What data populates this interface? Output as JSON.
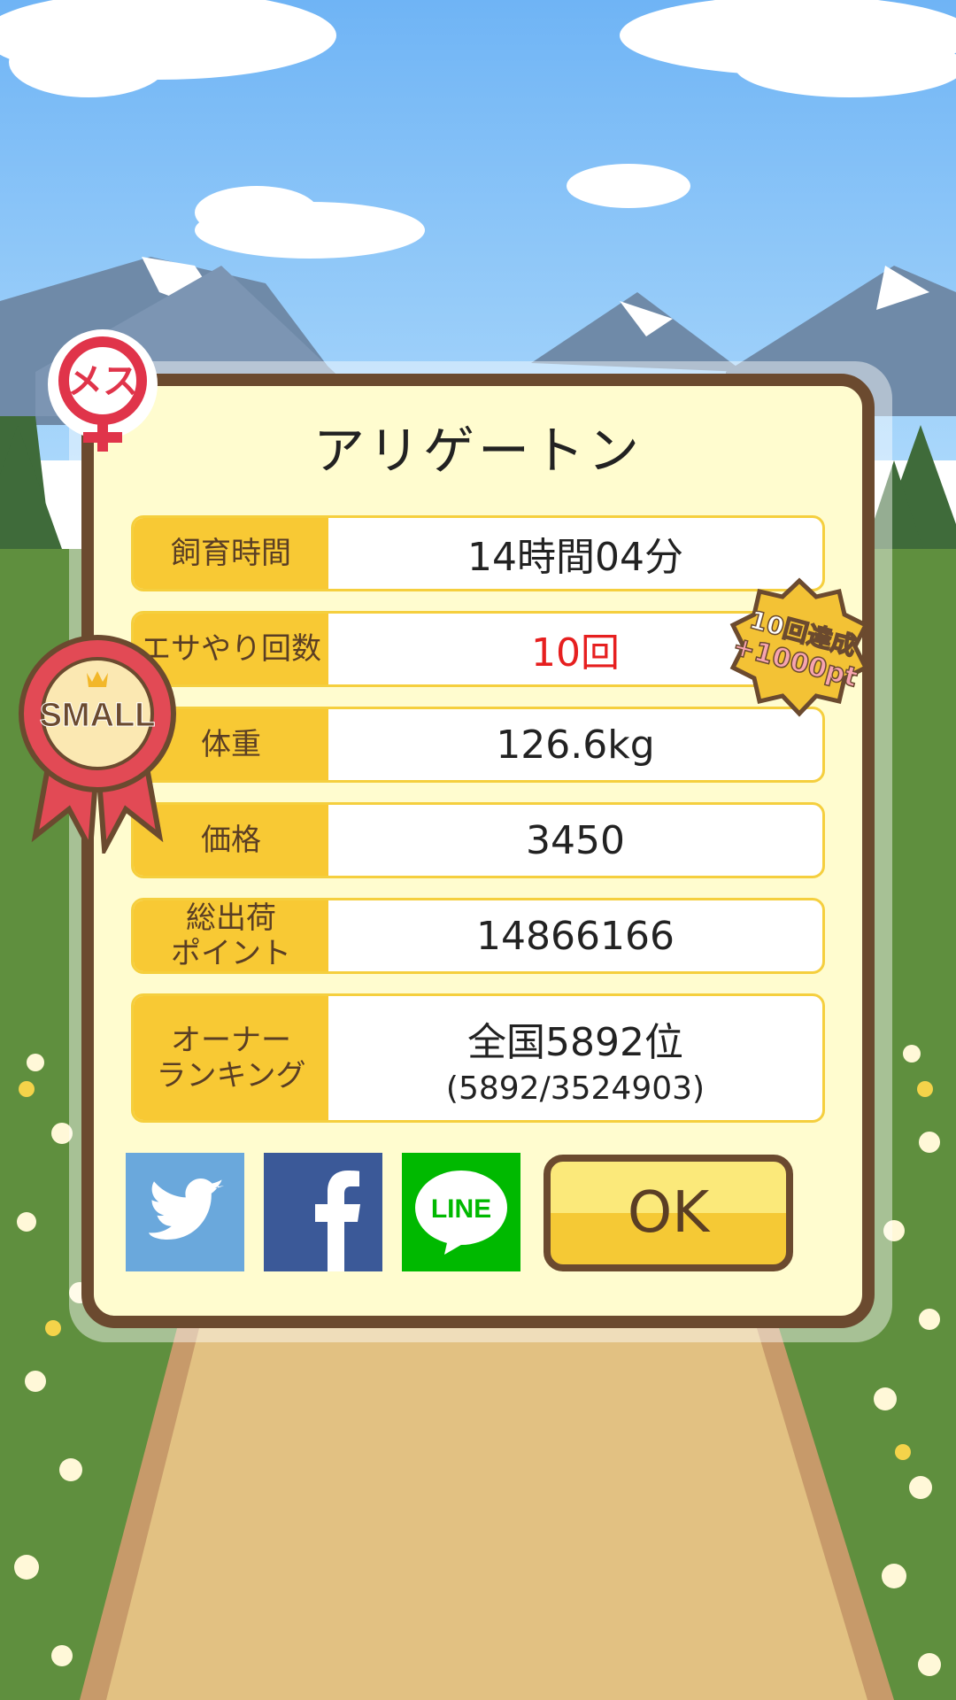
{
  "title": "アリゲートン",
  "gender_badge": {
    "text": "メス"
  },
  "size_ribbon": {
    "text": "SMALL"
  },
  "bonus_badge": {
    "line1": "10回達成",
    "line2": "+1000pt"
  },
  "rows": [
    {
      "label": "飼育時間",
      "value": "14時間04分"
    },
    {
      "label": "エサやり回数",
      "value": "10回",
      "value_color": "#e61f1f"
    },
    {
      "label": "体重",
      "value": "126.6kg"
    },
    {
      "label": "価格",
      "value": "3450"
    },
    {
      "label_line1": "総出荷",
      "label_line2": "ポイント",
      "value": "14866166"
    },
    {
      "label_line1": "オーナー",
      "label_line2": "ランキング",
      "value": "全国5892位",
      "value_sub": "(5892/3524903)"
    }
  ],
  "share": [
    {
      "name": "twitter",
      "color": "#6aa8dc"
    },
    {
      "name": "facebook",
      "color": "#3b5998"
    },
    {
      "name": "line",
      "color": "#00b900",
      "text": "LINE"
    }
  ],
  "ok_label": "OK",
  "colors": {
    "accent": "#f8c934",
    "border": "#6b4a2f",
    "panel": "#fffccf",
    "highlight": "#e61f1f"
  }
}
